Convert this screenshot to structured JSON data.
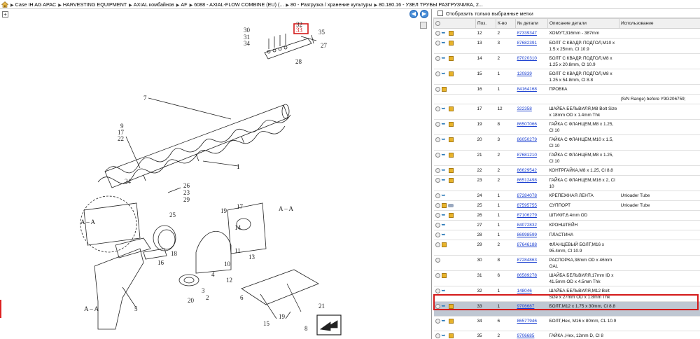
{
  "breadcrumb": [
    "Case IH AG APAC",
    "HARVESTING EQUIPMENT",
    "AXIAL комбайнов",
    "AF",
    "6088 - AXIAL-FLOW COMBINE (EU) (...",
    "80 - Разгрузка / хранение культуры",
    "80.180.16 - УЗЕЛ ТРУБЫ РАЗГРУЗЧИКА, 2..."
  ],
  "nav": {
    "back": "◀",
    "forward": "▶"
  },
  "diagram": {
    "highlight": "33",
    "labels": [
      {
        "id": "l30",
        "t": "30"
      },
      {
        "id": "l32",
        "t": "32"
      },
      {
        "id": "l33",
        "t": "33"
      },
      {
        "id": "l35",
        "t": "35"
      },
      {
        "id": "l31",
        "t": "31"
      },
      {
        "id": "l34",
        "t": "34"
      },
      {
        "id": "l27",
        "t": "27"
      },
      {
        "id": "l28",
        "t": "28"
      },
      {
        "id": "l7",
        "t": "7"
      },
      {
        "id": "l9",
        "t": "9"
      },
      {
        "id": "l17",
        "t": "17"
      },
      {
        "id": "l22",
        "t": "22"
      },
      {
        "id": "l1",
        "t": "1"
      },
      {
        "id": "l24",
        "t": "24"
      },
      {
        "id": "l26",
        "t": "26"
      },
      {
        "id": "l23",
        "t": "23"
      },
      {
        "id": "l29",
        "t": "29"
      },
      {
        "id": "l25",
        "t": "25"
      },
      {
        "id": "l18",
        "t": "18"
      },
      {
        "id": "l16",
        "t": "16"
      },
      {
        "id": "lAA1",
        "t": "A – A"
      },
      {
        "id": "l19",
        "t": "19"
      },
      {
        "id": "l17b",
        "t": "17"
      },
      {
        "id": "l14",
        "t": "14"
      },
      {
        "id": "l13",
        "t": "13"
      },
      {
        "id": "l11",
        "t": "11"
      },
      {
        "id": "l10",
        "t": "10"
      },
      {
        "id": "l12",
        "t": "12"
      },
      {
        "id": "l4",
        "t": "4"
      },
      {
        "id": "l3",
        "t": "3"
      },
      {
        "id": "l20",
        "t": "20"
      },
      {
        "id": "l2",
        "t": "2"
      },
      {
        "id": "l8",
        "t": "8"
      },
      {
        "id": "l6",
        "t": "6"
      },
      {
        "id": "l21",
        "t": "21"
      },
      {
        "id": "l15",
        "t": "15"
      },
      {
        "id": "l19b",
        "t": "19"
      },
      {
        "id": "l5",
        "t": "5"
      },
      {
        "id": "lAA2",
        "t": "A – A"
      },
      {
        "id": "lAA3",
        "t": "A – A"
      },
      {
        "id": "l1b",
        "t": "1"
      }
    ]
  },
  "filter": {
    "label": "Отобразить только выбранные метки",
    "checked": false
  },
  "table": {
    "headers": [
      "",
      "Поз.",
      "К-во",
      "№ детали",
      "Описание детали",
      "Использование"
    ],
    "rows": [
      {
        "pos": "12",
        "qty": "2",
        "part": "87339347",
        "desc": "ХОМУТ,316mm - 387mm",
        "use": "",
        "icons": "zab"
      },
      {
        "pos": "13",
        "qty": "3",
        "part": "87682391",
        "desc": "БОЛТ С КВАДР. ПОДГОЛ,M10 x 1.5 x 25mm, Cl 10.9",
        "use": "",
        "icons": "zab"
      },
      {
        "pos": "14",
        "qty": "2",
        "part": "87020310",
        "desc": "БОЛТ С КВАДР. ПОДГОЛ,M8 x 1.25 x 20.8mm, Cl 10.9",
        "use": "",
        "icons": "zab"
      },
      {
        "pos": "15",
        "qty": "1",
        "part": "120839",
        "desc": "БОЛТ С КВАДР. ПОДГОЛ,M8 x 1.25 x 54.8mm, Cl 8.8",
        "use": "",
        "icons": "zab"
      },
      {
        "pos": "16",
        "qty": "1",
        "part": "84164168",
        "desc": "ПРОВКА",
        "use": "",
        "icons": "zb"
      },
      {
        "pos": "",
        "qty": "",
        "part": "",
        "desc": "",
        "use": "(S/N Range) before Y9G206759;",
        "icons": ""
      },
      {
        "pos": "17",
        "qty": "12",
        "part": "322358",
        "desc": "ШАЙБА БЕЛЬВИЛЯ,M8 Bolt Size x 18mm OD x 1.4mm Thk",
        "use": "",
        "icons": "zab"
      },
      {
        "pos": "19",
        "qty": "8",
        "part": "86507066",
        "desc": "ГАЙКА С ФЛАНЦЕМ,M8 x 1.25, Cl 10",
        "use": "",
        "icons": "zab"
      },
      {
        "pos": "20",
        "qty": "3",
        "part": "86050279",
        "desc": "ГАЙКА С ФЛАНЦЕМ,M10 x 1.5, Cl 10",
        "use": "",
        "icons": "zab"
      },
      {
        "pos": "21",
        "qty": "2",
        "part": "87681210",
        "desc": "ГАЙКА С ФЛАНЦЕМ,M8 x 1.25, Cl 10",
        "use": "",
        "icons": "zab"
      },
      {
        "pos": "22",
        "qty": "2",
        "part": "86629542",
        "desc": "КОНТРГАЙКА,M8 x 1.25, Cl 8.8",
        "use": "",
        "icons": "zab"
      },
      {
        "pos": "23",
        "qty": "2",
        "part": "86512498",
        "desc": "ГАЙКА С ФЛАНЦЕМ,M16 x 2, Cl 10",
        "use": "",
        "icons": "zab"
      },
      {
        "pos": "24",
        "qty": "1",
        "part": "87284078",
        "desc": "КРЕПЕЖНАЯ ЛЕНТА",
        "use": "Unloader Tube",
        "icons": "za"
      },
      {
        "pos": "25",
        "qty": "1",
        "part": "87595755",
        "desc": "СУППОРТ",
        "use": "Unloader Tube",
        "icons": "zbk"
      },
      {
        "pos": "26",
        "qty": "1",
        "part": "87106279",
        "desc": "ШТИФТ,6.4mm OD",
        "use": "",
        "icons": "zab"
      },
      {
        "pos": "27",
        "qty": "1",
        "part": "84072832",
        "desc": "КРОНШТЕЙН",
        "use": "",
        "icons": "za"
      },
      {
        "pos": "28",
        "qty": "1",
        "part": "86998599",
        "desc": "ПЛАСТИНА",
        "use": "",
        "icons": "za"
      },
      {
        "pos": "29",
        "qty": "2",
        "part": "87646188",
        "desc": "ФЛАНЦЕВЫЙ БОЛТ,M16 x 95.4mm, Cl 10.9",
        "use": "",
        "icons": "zb"
      },
      {
        "pos": "30",
        "qty": "8",
        "part": "87284863",
        "desc": "РАСПОРКА,38mm OD x 46mm OAL",
        "use": "",
        "icons": "z"
      },
      {
        "pos": "31",
        "qty": "6",
        "part": "86589278",
        "desc": "ШАЙБА БЕЛЬВИЛЯ,17mm ID x 41.5mm OD x 4.5mm Thk",
        "use": "",
        "icons": "zb"
      },
      {
        "pos": "32",
        "qty": "1",
        "part": "148046",
        "desc": "ШАЙБА БЕЛЬВИЛЯ,M12 Bolt Size x 27mm OD x 1.8mm Thk",
        "use": "",
        "icons": "za"
      },
      {
        "pos": "33",
        "qty": "1",
        "part": "9706687",
        "desc": "БОЛТ,M12 x 1.75 x 30mm, Cl 8.8",
        "use": "",
        "icons": "zab",
        "selected": true
      },
      {
        "pos": "34",
        "qty": "6",
        "part": "86577946",
        "desc": "БОЛТ,Hex, M16 x 80mm, CL 10.9",
        "use": "",
        "icons": "zab"
      },
      {
        "pos": "35",
        "qty": "2",
        "part": "9706685",
        "desc": "ГАЙКА ,Hex, 12mm D, Cl 8",
        "use": "",
        "icons": "zab"
      }
    ]
  }
}
